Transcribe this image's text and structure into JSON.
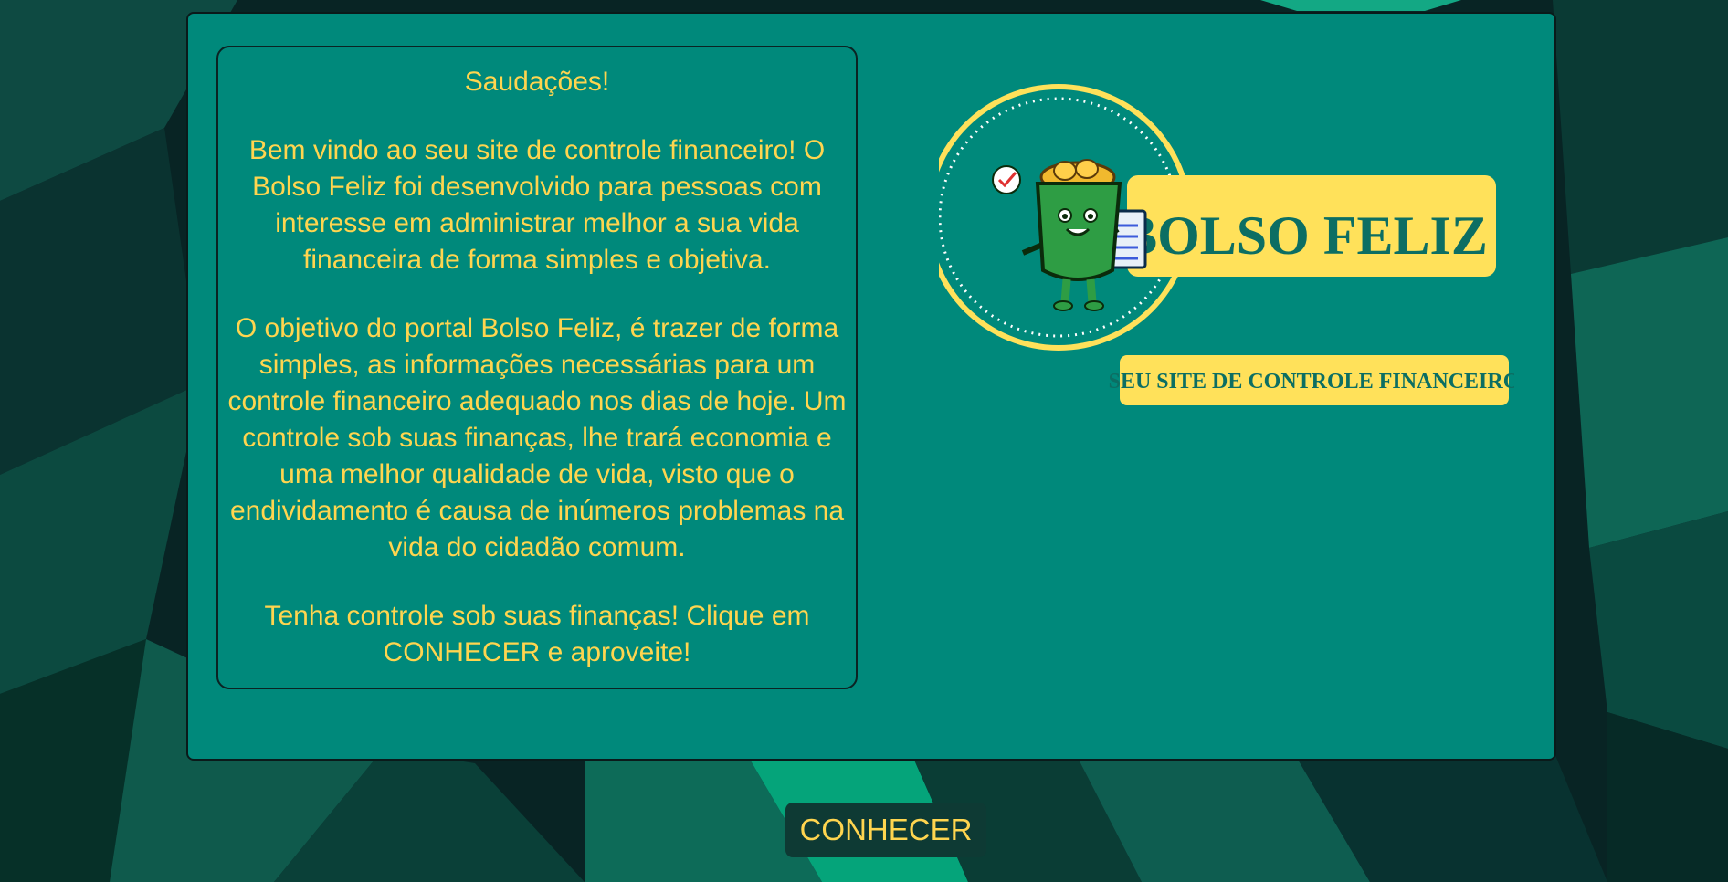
{
  "colors": {
    "panel_bg": "#00897b",
    "text_accent": "#ffd54f",
    "button_bg": "#0e3a34",
    "logo_yellow": "#ffe15a",
    "logo_text": "#0c6e63"
  },
  "welcome": {
    "greeting": "Saudações!",
    "intro": "Bem vindo ao seu site de controle financeiro! O Bolso Feliz foi desenvolvido para pessoas com interesse em administrar melhor a sua vida financeira de forma simples e objetiva.",
    "objective": "O objetivo do portal Bolso Feliz, é trazer de forma simples, as informações necessárias para um controle financeiro adequado nos dias de hoje. Um controle sob suas finanças, lhe trará economia e uma melhor qualidade de vida, visto que o endividamento é causa de inúmeros problemas na vida do cidadão comum.",
    "cta_text": "Tenha controle sob suas finanças! Clique em CONHECER e aproveite!"
  },
  "logo": {
    "title": "BOLSO FELIZ",
    "tagline": "SEU SITE DE CONTROLE FINANCEIRO",
    "mascot_icon": "happy-green-pocket-mascot"
  },
  "actions": {
    "conhecer_label": "CONHECER"
  }
}
